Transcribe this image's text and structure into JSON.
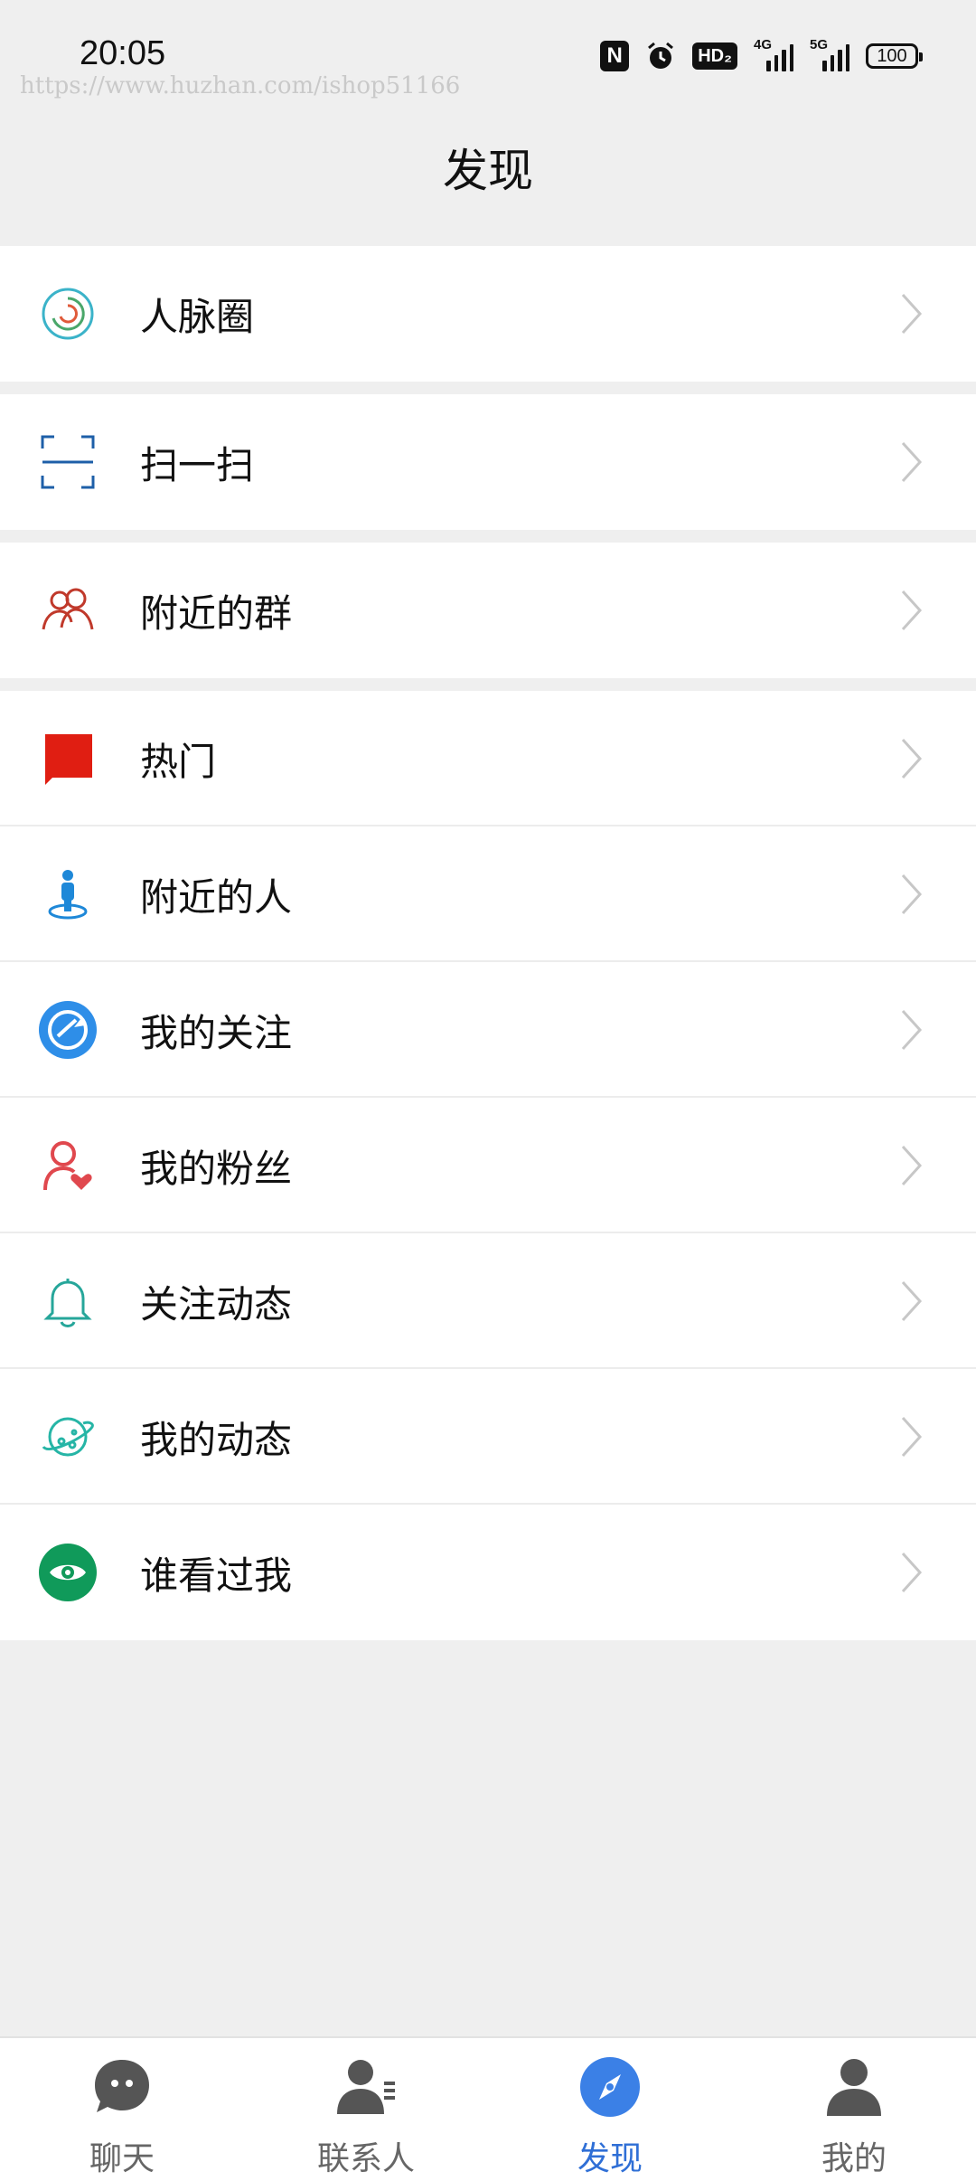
{
  "status_bar": {
    "time": "20:05",
    "watermark": "https://www.huzhan.com/ishop51166",
    "icons": [
      "nfc-icon",
      "alarm-icon",
      "hd-icon",
      "signal-4g-icon",
      "signal-5g-icon",
      "battery-icon"
    ],
    "hd_label": "HD₂",
    "signal_4g_label": "4G",
    "signal_5g_label": "5G",
    "battery_level": "100"
  },
  "header": {
    "title": "发现"
  },
  "menu": [
    {
      "label": "人脉圈",
      "icon": "network-circle-icon",
      "color": "#1aa7b8"
    },
    {
      "label": "扫一扫",
      "icon": "scan-icon",
      "color": "#1e5fa8"
    },
    {
      "label": "附近的群",
      "icon": "group-icon",
      "color": "#c0392b"
    },
    {
      "label": "热门",
      "icon": "flag-icon",
      "color": "#e01e12"
    },
    {
      "label": "附近的人",
      "icon": "location-person-icon",
      "color": "#1e88d8"
    },
    {
      "label": "我的关注",
      "icon": "follow-icon",
      "color": "#2e8ee8"
    },
    {
      "label": "我的粉丝",
      "icon": "fans-icon",
      "color": "#e0484e"
    },
    {
      "label": "关注动态",
      "icon": "bell-icon",
      "color": "#26a69a"
    },
    {
      "label": "我的动态",
      "icon": "planet-icon",
      "color": "#26b5a6"
    },
    {
      "label": "谁看过我",
      "icon": "eye-icon",
      "color": "#109a5a"
    }
  ],
  "tabbar": {
    "tabs": [
      {
        "label": "聊天",
        "icon": "chat-bubble-icon",
        "active": false
      },
      {
        "label": "联系人",
        "icon": "contacts-icon",
        "active": false
      },
      {
        "label": "发现",
        "icon": "compass-icon",
        "active": true
      },
      {
        "label": "我的",
        "icon": "profile-icon",
        "active": false
      }
    ],
    "active_color": "#2f6fd6",
    "inactive_color": "#555555"
  }
}
